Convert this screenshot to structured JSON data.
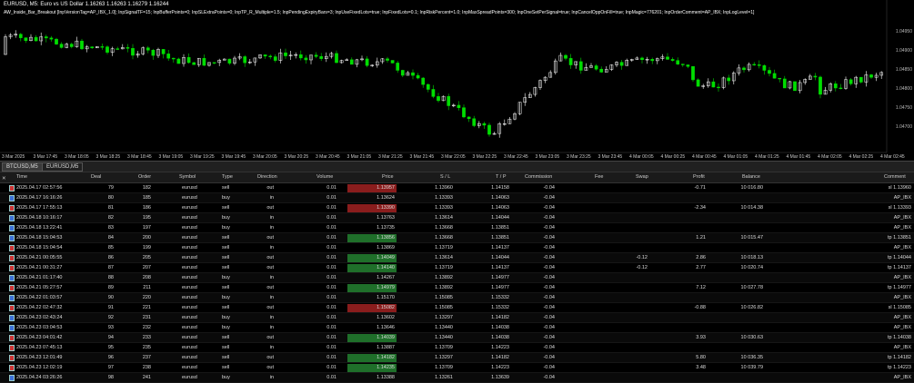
{
  "chart": {
    "title": "EURUSD, M5:  Euro vs US Dollar  1.16263 1.16263 1.16279 1.16244",
    "params": "AW_Inside_Bar_Breakout [InpVersionTag=AP_IBX_1.0]; InpSignalTF=15; InpBufferPoints=0; InpSLExtraPoints=0; InpTP_R_Multiple=1.5; InpPendingExpiryBars=3; InpUseFixedLots=true; InpFixedLots=0.1; InpRiskPercent=1.0; InpMaxSpreadPoints=300; InpOneSetPerSignal=true; InpCancelOppOnFill=true; InpMagic=776201; InpOrderComment=AP_IBX; InpLogLevel=1]",
    "price_labels": [
      "1.04950",
      "1.04900",
      "1.04850",
      "1.04800",
      "1.04750",
      "1.04700"
    ],
    "time_labels": [
      "3 Mar 2025",
      "3 Mar 17:45",
      "3 Mar 18:05",
      "3 Mar 18:25",
      "3 Mar 18:45",
      "3 Mar 19:05",
      "3 Mar 19:25",
      "3 Mar 19:45",
      "3 Mar 20:05",
      "3 Mar 20:25",
      "3 Mar 20:45",
      "3 Mar 21:05",
      "3 Mar 21:25",
      "3 Mar 21:45",
      "3 Mar 22:05",
      "3 Mar 22:25",
      "3 Mar 22:45",
      "3 Mar 23:05",
      "3 Mar 23:25",
      "3 Mar 23:45",
      "4 Mar 00:05",
      "4 Mar 00:25",
      "4 Mar 00:45",
      "4 Mar 01:05",
      "4 Mar 01:25",
      "4 Mar 01:45",
      "4 Mar 02:05",
      "4 Mar 02:25",
      "4 Mar 02:45"
    ],
    "colors": {
      "bull": "#ffffff",
      "bear": "#00dd00",
      "bg": "#000000"
    }
  },
  "tabs": [
    {
      "label": "BTCUSD,M5"
    },
    {
      "label": "EURUSD,M5"
    }
  ],
  "columns": [
    "Time",
    "Deal",
    "Order",
    "Symbol",
    "Type",
    "Direction",
    "Volume",
    "Price",
    "S / L",
    "T / P",
    "Commission",
    "Fee",
    "Swap",
    "Profit",
    "Balance",
    "Comment"
  ],
  "rows": [
    {
      "time": "2025.04.17 02:57:56",
      "deal": "79",
      "order": "182",
      "symbol": "eurusd",
      "type": "sell",
      "dir": "out",
      "vol": "0.01",
      "price": "1.13957",
      "sl": "1.13960",
      "tp": "1.14158",
      "comm": "-0.04",
      "swap": "",
      "profit": "-0.71",
      "bal": "10 016.80",
      "cmt": "sl 1.13960",
      "pc": "red",
      "ic": "red"
    },
    {
      "time": "2025.04.17 16:16:26",
      "deal": "80",
      "order": "185",
      "symbol": "eurusd",
      "type": "buy",
      "dir": "in",
      "vol": "0.01",
      "price": "1.13624",
      "sl": "1.13393",
      "tp": "1.14063",
      "comm": "-0.04",
      "swap": "",
      "profit": "",
      "bal": "",
      "cmt": "AP_IBX",
      "pc": "",
      "ic": ""
    },
    {
      "time": "2025.04.17 17:55:13",
      "deal": "81",
      "order": "186",
      "symbol": "eurusd",
      "type": "sell",
      "dir": "out",
      "vol": "0.01",
      "price": "1.13390",
      "sl": "1.13393",
      "tp": "1.14063",
      "comm": "-0.04",
      "swap": "",
      "profit": "-2.34",
      "bal": "10 014.38",
      "cmt": "sl 1.13393",
      "pc": "red",
      "ic": "red"
    },
    {
      "time": "2025.04.18 10:16:17",
      "deal": "82",
      "order": "195",
      "symbol": "eurusd",
      "type": "buy",
      "dir": "in",
      "vol": "0.01",
      "price": "1.13763",
      "sl": "1.13614",
      "tp": "1.14044",
      "comm": "-0.04",
      "swap": "",
      "profit": "",
      "bal": "",
      "cmt": "AP_IBX",
      "pc": "",
      "ic": ""
    },
    {
      "time": "2025.04.18 13:22:41",
      "deal": "83",
      "order": "197",
      "symbol": "eurusd",
      "type": "buy",
      "dir": "in",
      "vol": "0.01",
      "price": "1.13735",
      "sl": "1.13668",
      "tp": "1.13851",
      "comm": "-0.04",
      "swap": "",
      "profit": "",
      "bal": "",
      "cmt": "AP_IBX",
      "pc": "",
      "ic": ""
    },
    {
      "time": "2025.04.18 15:04:53",
      "deal": "84",
      "order": "200",
      "symbol": "eurusd",
      "type": "sell",
      "dir": "out",
      "vol": "0.01",
      "price": "1.13856",
      "sl": "1.13668",
      "tp": "1.13851",
      "comm": "-0.04",
      "swap": "",
      "profit": "1.21",
      "bal": "10 015.47",
      "cmt": "tp 1.13851",
      "pc": "green",
      "ic": ""
    },
    {
      "time": "2025.04.18 15:04:54",
      "deal": "85",
      "order": "199",
      "symbol": "eurusd",
      "type": "sell",
      "dir": "in",
      "vol": "0.01",
      "price": "1.13869",
      "sl": "1.13719",
      "tp": "1.14137",
      "comm": "-0.04",
      "swap": "",
      "profit": "",
      "bal": "",
      "cmt": "AP_IBX",
      "pc": "",
      "ic": "red"
    },
    {
      "time": "2025.04.21 00:05:55",
      "deal": "86",
      "order": "205",
      "symbol": "eurusd",
      "type": "sell",
      "dir": "out",
      "vol": "0.01",
      "price": "1.14049",
      "sl": "1.13614",
      "tp": "1.14044",
      "comm": "-0.04",
      "swap": "-0.12",
      "profit": "2.86",
      "bal": "10 018.13",
      "cmt": "tp 1.14044",
      "pc": "green",
      "ic": "red"
    },
    {
      "time": "2025.04.21 00:31:27",
      "deal": "87",
      "order": "207",
      "symbol": "eurusd",
      "type": "sell",
      "dir": "out",
      "vol": "0.01",
      "price": "1.14140",
      "sl": "1.13719",
      "tp": "1.14137",
      "comm": "-0.04",
      "swap": "-0.12",
      "profit": "2.77",
      "bal": "10 020.74",
      "cmt": "tp 1.14137",
      "pc": "green",
      "ic": "red"
    },
    {
      "time": "2025.04.21 01:17:40",
      "deal": "88",
      "order": "208",
      "symbol": "eurusd",
      "type": "buy",
      "dir": "in",
      "vol": "0.01",
      "price": "1.14267",
      "sl": "1.13892",
      "tp": "1.14977",
      "comm": "-0.04",
      "swap": "",
      "profit": "",
      "bal": "",
      "cmt": "AP_IBX",
      "pc": "",
      "ic": ""
    },
    {
      "time": "2025.04.21 05:27:57",
      "deal": "89",
      "order": "211",
      "symbol": "eurusd",
      "type": "sell",
      "dir": "out",
      "vol": "0.01",
      "price": "1.14979",
      "sl": "1.13892",
      "tp": "1.14977",
      "comm": "-0.04",
      "swap": "",
      "profit": "7.12",
      "bal": "10 027.78",
      "cmt": "tp 1.14977",
      "pc": "green",
      "ic": "red"
    },
    {
      "time": "2025.04.22 01:03:57",
      "deal": "90",
      "order": "220",
      "symbol": "eurusd",
      "type": "buy",
      "dir": "in",
      "vol": "0.01",
      "price": "1.15170",
      "sl": "1.15085",
      "tp": "1.15332",
      "comm": "-0.04",
      "swap": "",
      "profit": "",
      "bal": "",
      "cmt": "AP_IBX",
      "pc": "",
      "ic": ""
    },
    {
      "time": "2025.04.22 02:47:32",
      "deal": "91",
      "order": "221",
      "symbol": "eurusd",
      "type": "sell",
      "dir": "out",
      "vol": "0.01",
      "price": "1.15082",
      "sl": "1.15085",
      "tp": "1.15332",
      "comm": "-0.04",
      "swap": "",
      "profit": "-0.88",
      "bal": "10 026.82",
      "cmt": "sl 1.15085",
      "pc": "red",
      "ic": "red"
    },
    {
      "time": "2025.04.23 02:43:24",
      "deal": "92",
      "order": "231",
      "symbol": "eurusd",
      "type": "buy",
      "dir": "in",
      "vol": "0.01",
      "price": "1.13602",
      "sl": "1.13297",
      "tp": "1.14182",
      "comm": "-0.04",
      "swap": "",
      "profit": "",
      "bal": "",
      "cmt": "AP_IBX",
      "pc": "",
      "ic": ""
    },
    {
      "time": "2025.04.23 03:04:53",
      "deal": "93",
      "order": "232",
      "symbol": "eurusd",
      "type": "buy",
      "dir": "in",
      "vol": "0.01",
      "price": "1.13646",
      "sl": "1.13440",
      "tp": "1.14038",
      "comm": "-0.04",
      "swap": "",
      "profit": "",
      "bal": "",
      "cmt": "AP_IBX",
      "pc": "",
      "ic": ""
    },
    {
      "time": "2025.04.23 04:01:42",
      "deal": "94",
      "order": "233",
      "symbol": "eurusd",
      "type": "sell",
      "dir": "out",
      "vol": "0.01",
      "price": "1.14039",
      "sl": "1.13440",
      "tp": "1.14038",
      "comm": "-0.04",
      "swap": "",
      "profit": "3.93",
      "bal": "10 030.63",
      "cmt": "tp 1.14038",
      "pc": "green",
      "ic": "red"
    },
    {
      "time": "2025.04.23 07:45:13",
      "deal": "95",
      "order": "235",
      "symbol": "eurusd",
      "type": "sell",
      "dir": "in",
      "vol": "0.01",
      "price": "1.13887",
      "sl": "1.13709",
      "tp": "1.14223",
      "comm": "-0.04",
      "swap": "",
      "profit": "",
      "bal": "",
      "cmt": "AP_IBX",
      "pc": "",
      "ic": "red"
    },
    {
      "time": "2025.04.23 12:01:49",
      "deal": "96",
      "order": "237",
      "symbol": "eurusd",
      "type": "sell",
      "dir": "out",
      "vol": "0.01",
      "price": "1.14182",
      "sl": "1.13297",
      "tp": "1.14182",
      "comm": "-0.04",
      "swap": "",
      "profit": "5.80",
      "bal": "10 036.35",
      "cmt": "tp 1.14182",
      "pc": "green",
      "ic": "red"
    },
    {
      "time": "2025.04.23 12:02:19",
      "deal": "97",
      "order": "238",
      "symbol": "eurusd",
      "type": "sell",
      "dir": "out",
      "vol": "0.01",
      "price": "1.14235",
      "sl": "1.13709",
      "tp": "1.14223",
      "comm": "-0.04",
      "swap": "",
      "profit": "3.48",
      "bal": "10 039.79",
      "cmt": "tp 1.14223",
      "pc": "green",
      "ic": "red"
    },
    {
      "time": "2025.04.24 03:26:26",
      "deal": "98",
      "order": "241",
      "symbol": "eurusd",
      "type": "buy",
      "dir": "in",
      "vol": "0.01",
      "price": "1.13388",
      "sl": "1.13261",
      "tp": "1.13639",
      "comm": "-0.04",
      "swap": "",
      "profit": "",
      "bal": "",
      "cmt": "AP_IBX",
      "pc": "",
      "ic": ""
    }
  ]
}
